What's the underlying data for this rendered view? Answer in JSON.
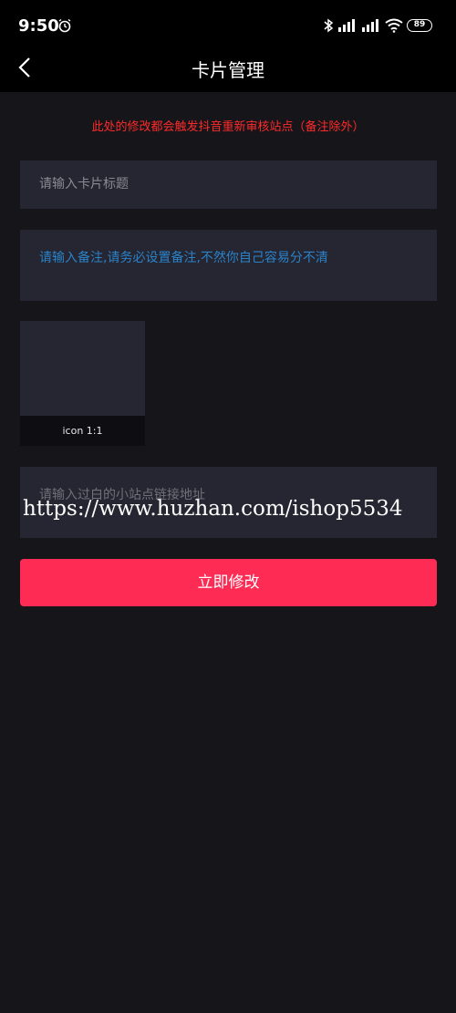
{
  "status_bar": {
    "time": "9:50",
    "battery": "89",
    "icons": [
      "alarm-icon",
      "bluetooth-icon",
      "signal-icon",
      "wifi-icon",
      "battery-icon"
    ]
  },
  "nav": {
    "title": "卡片管理",
    "back_icon": "chevron-left-icon"
  },
  "warning": "此处的修改都会触发抖音重新审核站点（备注除外）",
  "form": {
    "title_placeholder": "请输入卡片标题",
    "note_placeholder": "请输入备注,请务必设置备注,不然你自己容易分不清",
    "icon_caption": "icon 1:1",
    "url_placeholder": "请输入过白的小站点链接地址"
  },
  "watermark": "https://www.huzhan.com/ishop5534",
  "submit_label": "立即修改",
  "colors": {
    "accent": "#fe2c55",
    "warning": "#ff2a2a",
    "field_bg": "#252631",
    "page_bg": "#161519"
  }
}
